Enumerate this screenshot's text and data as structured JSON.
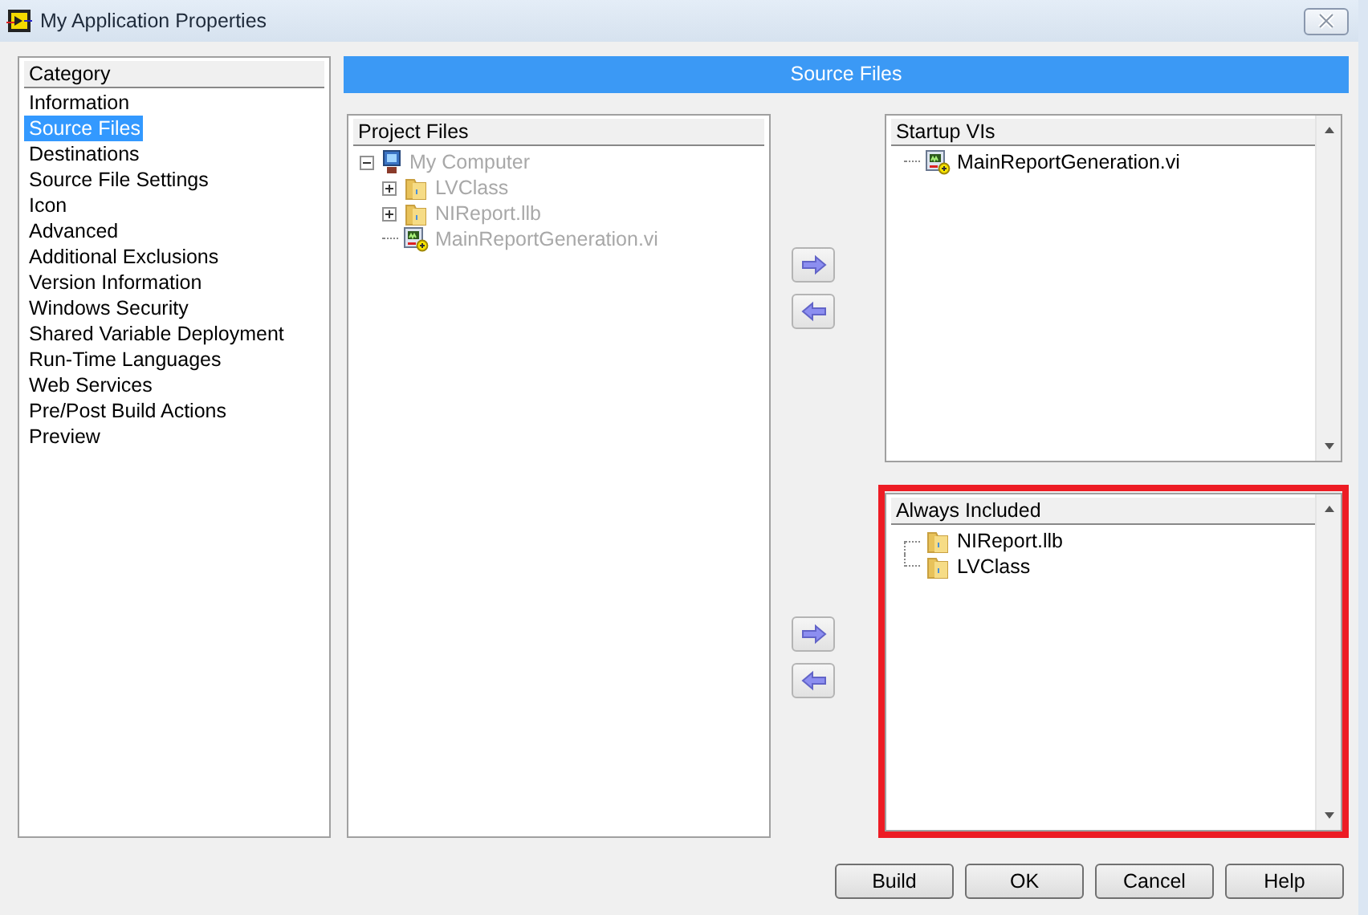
{
  "window": {
    "title": "My Application Properties"
  },
  "category": {
    "header": "Category",
    "items": [
      {
        "label": "Information",
        "selected": false
      },
      {
        "label": "Source Files",
        "selected": true
      },
      {
        "label": "Destinations",
        "selected": false
      },
      {
        "label": "Source File Settings",
        "selected": false
      },
      {
        "label": "Icon",
        "selected": false
      },
      {
        "label": "Advanced",
        "selected": false
      },
      {
        "label": "Additional Exclusions",
        "selected": false
      },
      {
        "label": "Version Information",
        "selected": false
      },
      {
        "label": "Windows Security",
        "selected": false
      },
      {
        "label": "Shared Variable Deployment",
        "selected": false
      },
      {
        "label": "Run-Time Languages",
        "selected": false
      },
      {
        "label": "Web Services",
        "selected": false
      },
      {
        "label": "Pre/Post Build Actions",
        "selected": false
      },
      {
        "label": "Preview",
        "selected": false
      }
    ]
  },
  "page_title": "Source Files",
  "project_files": {
    "header": "Project Files",
    "tree": [
      {
        "label": "My Computer",
        "kind": "computer",
        "disabled": true,
        "expanded": true,
        "children": [
          {
            "label": "LVClass",
            "kind": "folder",
            "disabled": true,
            "expanded": false
          },
          {
            "label": "NIReport.llb",
            "kind": "folder",
            "disabled": true,
            "expanded": false
          },
          {
            "label": "MainReportGeneration.vi",
            "kind": "vi",
            "disabled": true
          }
        ]
      }
    ]
  },
  "startup_vis": {
    "header": "Startup VIs",
    "highlighted": false,
    "items": [
      {
        "label": "MainReportGeneration.vi",
        "kind": "vi"
      }
    ]
  },
  "always_included": {
    "header": "Always Included",
    "highlighted": true,
    "items": [
      {
        "label": "NIReport.llb",
        "kind": "folder"
      },
      {
        "label": "LVClass",
        "kind": "folder"
      }
    ]
  },
  "buttons": [
    {
      "label": "Build"
    },
    {
      "label": "OK"
    },
    {
      "label": "Cancel"
    },
    {
      "label": "Help"
    }
  ]
}
